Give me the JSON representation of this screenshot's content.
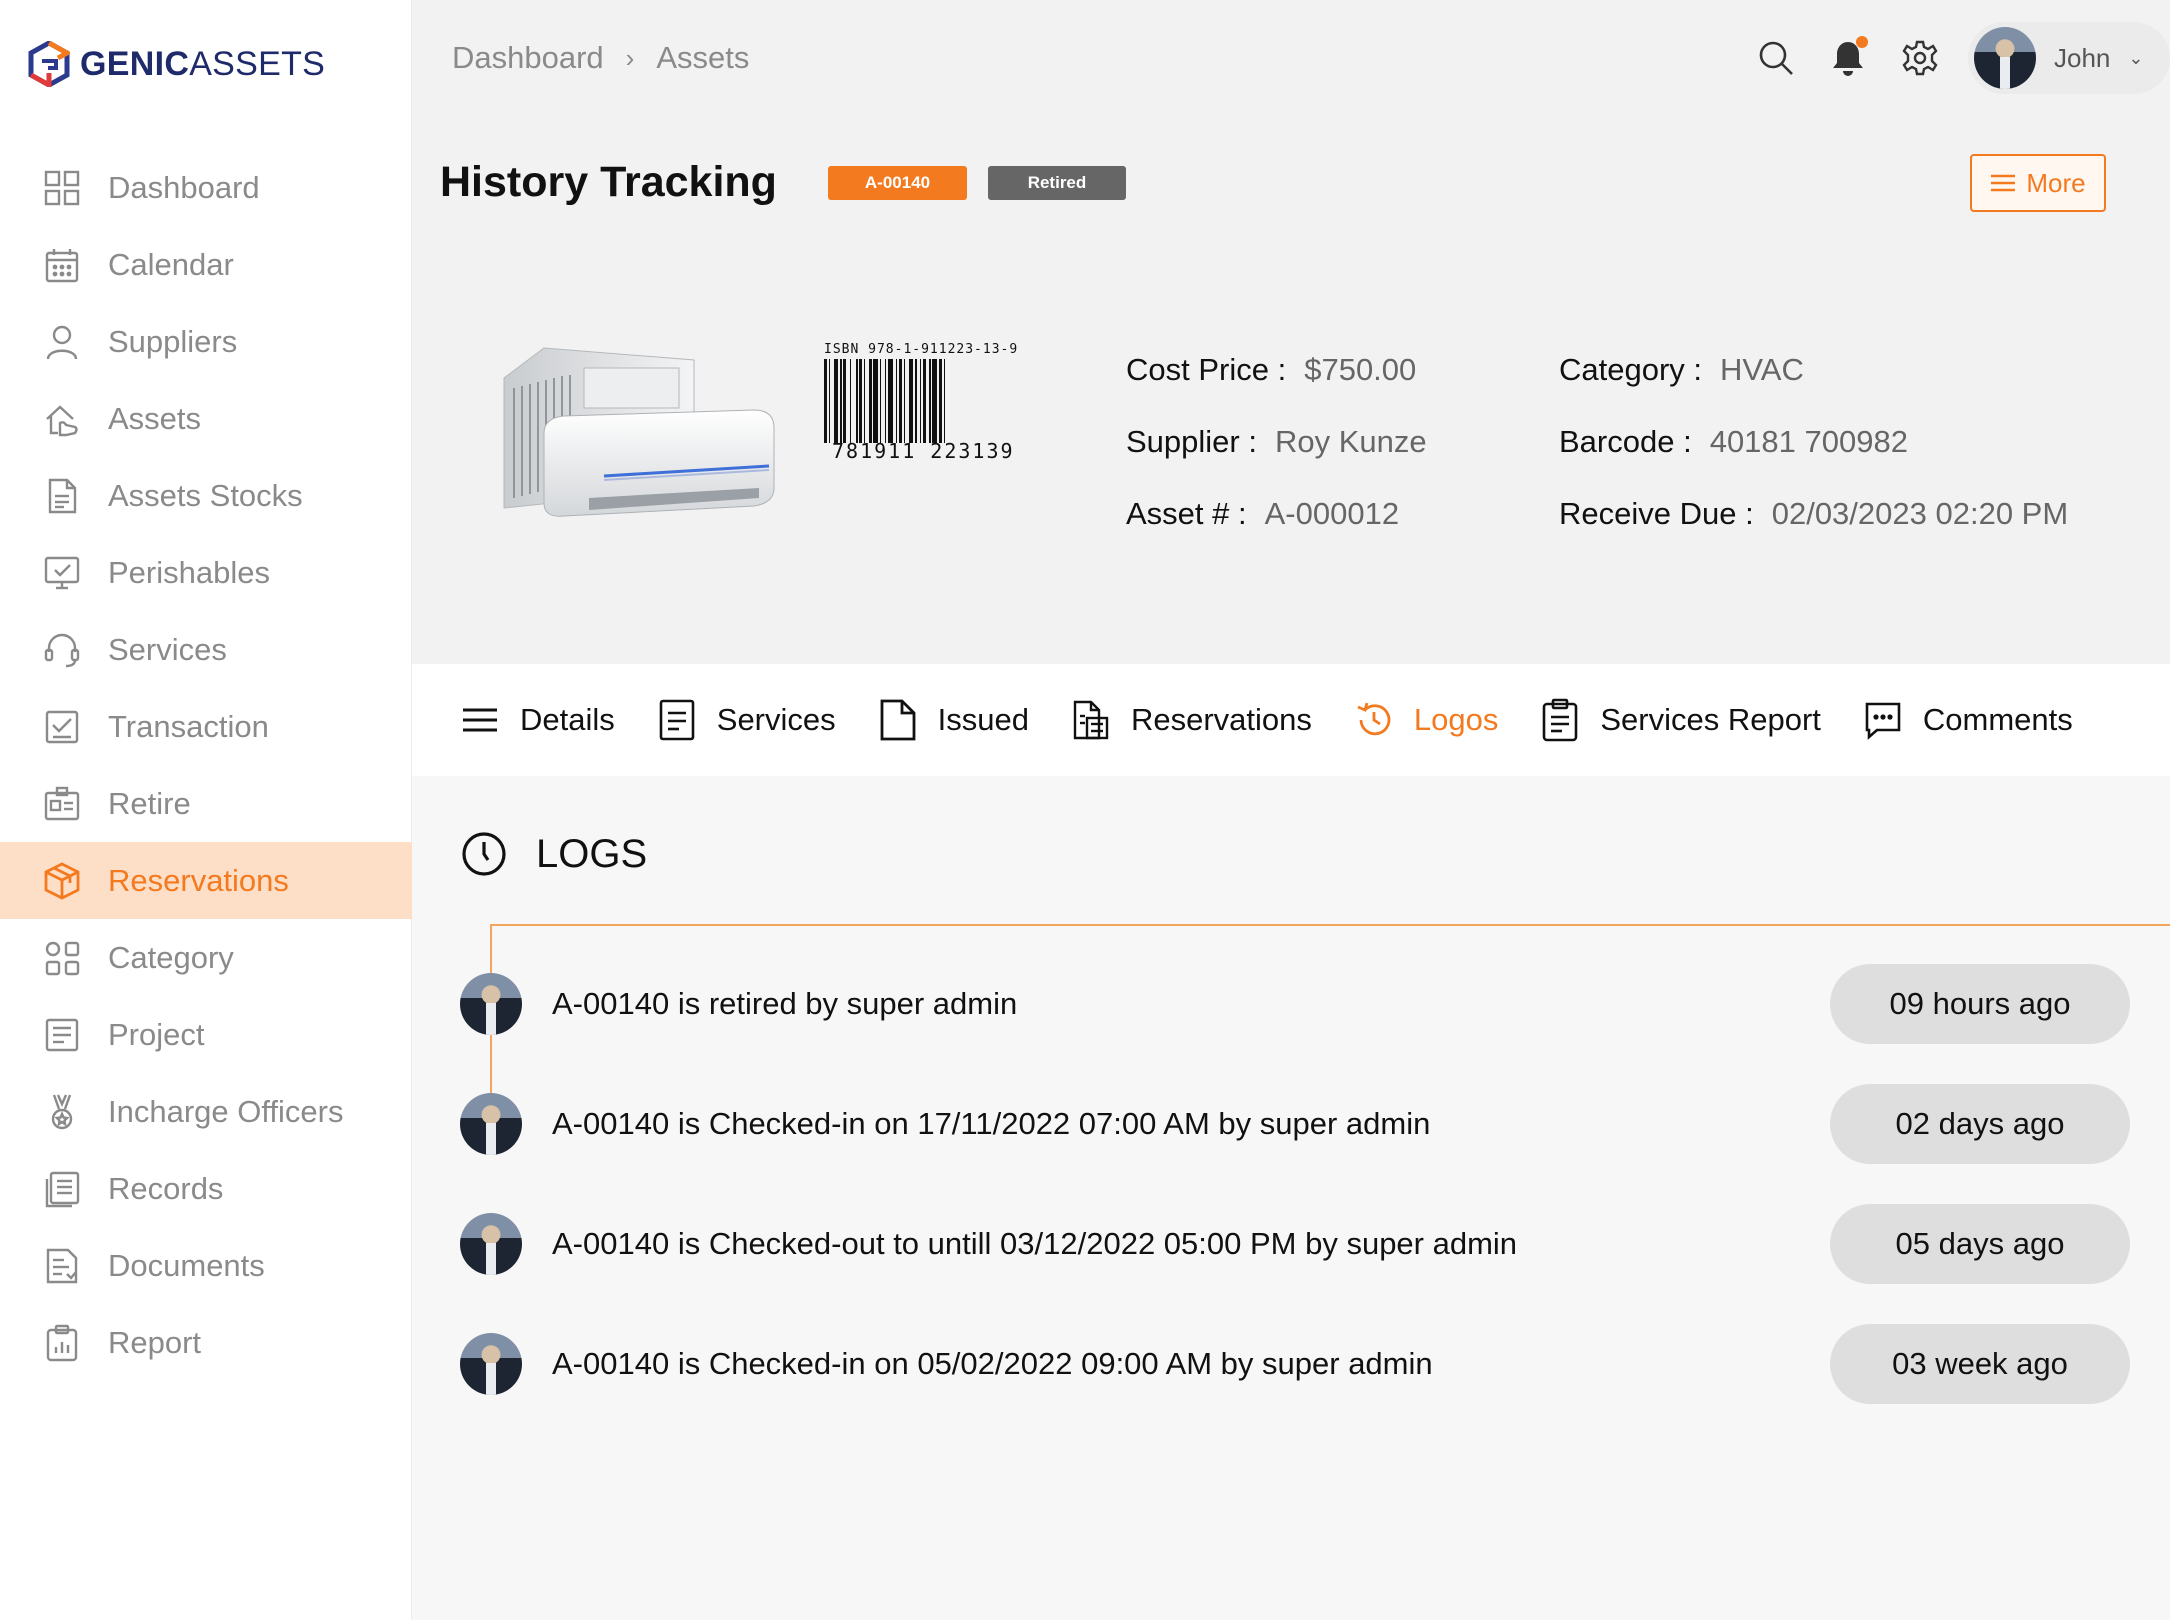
{
  "brand": {
    "bold": "GENIC",
    "light": "ASSETS"
  },
  "sidebar": {
    "items": [
      {
        "label": "Dashboard",
        "icon": "grid-icon"
      },
      {
        "label": "Calendar",
        "icon": "calendar-icon"
      },
      {
        "label": "Suppliers",
        "icon": "user-icon"
      },
      {
        "label": "Assets",
        "icon": "asset-hand-icon"
      },
      {
        "label": "Assets Stocks",
        "icon": "document-icon"
      },
      {
        "label": "Perishables",
        "icon": "monitor-check-icon"
      },
      {
        "label": "Services",
        "icon": "headset-icon"
      },
      {
        "label": "Transaction",
        "icon": "checklist-icon"
      },
      {
        "label": "Retire",
        "icon": "id-card-icon"
      },
      {
        "label": "Reservations",
        "icon": "box-icon",
        "active": true
      },
      {
        "label": "Category",
        "icon": "category-icon"
      },
      {
        "label": "Project",
        "icon": "project-icon"
      },
      {
        "label": "Incharge Officers",
        "icon": "medal-icon"
      },
      {
        "label": "Records",
        "icon": "records-icon"
      },
      {
        "label": "Documents",
        "icon": "documents-icon"
      },
      {
        "label": "Report",
        "icon": "report-icon"
      }
    ]
  },
  "header": {
    "breadcrumb": [
      "Dashboard",
      "Assets"
    ],
    "user_name": "John"
  },
  "hero": {
    "title": "History Tracking",
    "asset_badge": "A-00140",
    "status_badge": "Retired",
    "more_label": "More",
    "barcode_top": "ISBN 978-1-911223-13-9",
    "barcode_bottom": "781911 223139",
    "details_left": [
      {
        "key": "Cost Price :",
        "value": "$750.00"
      },
      {
        "key": "Supplier :",
        "value": "Roy Kunze"
      },
      {
        "key": "Asset # :",
        "value": "A-000012"
      }
    ],
    "details_right": [
      {
        "key": "Category :",
        "value": "HVAC"
      },
      {
        "key": "Barcode :",
        "value": "40181 700982"
      },
      {
        "key": "Receive Due :",
        "value": "02/03/2023 02:20 PM"
      }
    ]
  },
  "tabs": [
    {
      "label": "Details",
      "icon": "menu-icon"
    },
    {
      "label": "Services",
      "icon": "file-lines-icon"
    },
    {
      "label": "Issued",
      "icon": "file-icon"
    },
    {
      "label": "Reservations",
      "icon": "files-icon"
    },
    {
      "label": "Logos",
      "icon": "history-icon",
      "active": true
    },
    {
      "label": "Services Report",
      "icon": "clipboard-icon"
    },
    {
      "label": "Comments",
      "icon": "comment-icon"
    }
  ],
  "logs": {
    "title": "LOGS",
    "entries": [
      {
        "text": "A-00140 is retired by super admin",
        "time": "09 hours ago"
      },
      {
        "text": "A-00140 is Checked-in on 17/11/2022  07:00 AM by super admin",
        "time": "02 days ago"
      },
      {
        "text": "A-00140 is Checked-out to untill 03/12/2022  05:00 PM by super admin",
        "time": "05 days ago"
      },
      {
        "text": "A-00140 is Checked-in on 05/02/2022  09:00 AM by super admin",
        "time": "03 week ago"
      }
    ]
  },
  "colors": {
    "accent": "#f47a20",
    "active_bg": "#fddfc8",
    "muted_text": "#8a8a8a",
    "retired_badge": "#666666"
  }
}
